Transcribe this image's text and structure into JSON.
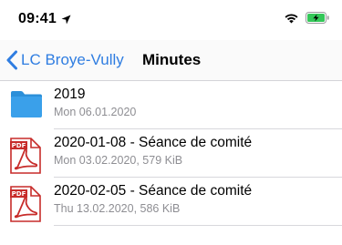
{
  "status_bar": {
    "time": "09:41",
    "location_icon": "location-arrow-icon",
    "wifi_icon": "wifi-icon",
    "battery_icon": "battery-charging-icon",
    "battery_color": "#34c759"
  },
  "nav": {
    "back_label": "LC Broye-Vully",
    "title": "Minutes",
    "accent_color": "#2f7de1"
  },
  "items": [
    {
      "type": "folder",
      "icon": "folder-icon",
      "title": "2019",
      "subtitle": "Mon 06.01.2020"
    },
    {
      "type": "pdf",
      "icon": "pdf-file-icon",
      "badge": "PDF",
      "title": "2020-01-08 - Séance de comité",
      "subtitle": "Mon 03.02.2020, 579 KiB"
    },
    {
      "type": "pdf",
      "icon": "pdf-file-icon",
      "badge": "PDF",
      "title": "2020-02-05 - Séance de comité",
      "subtitle": "Thu 13.02.2020, 586 KiB"
    }
  ]
}
